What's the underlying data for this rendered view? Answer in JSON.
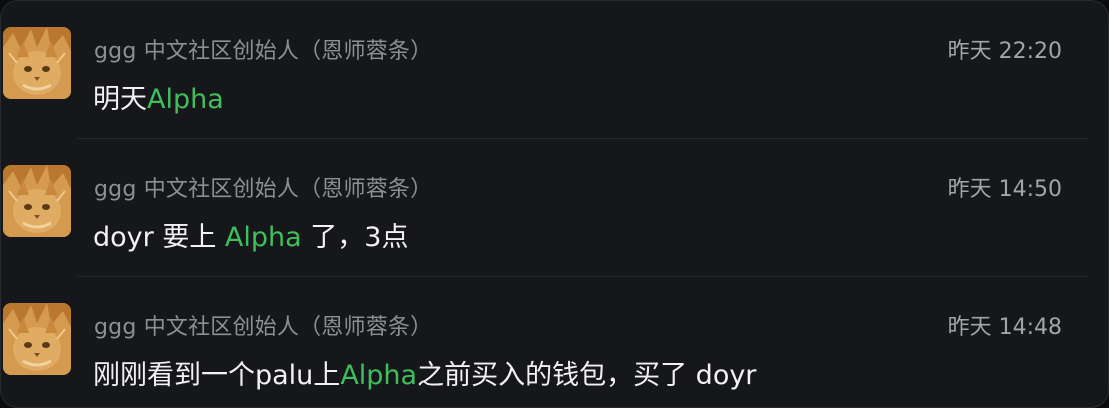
{
  "messages": [
    {
      "sender": "ggg 中文社区创始人（恩师蓉条）",
      "time": "昨天 22:20",
      "text_before": "明天",
      "highlight": "Alpha",
      "text_after": "",
      "avatar_icon": "orange-cat-avatar"
    },
    {
      "sender": "ggg 中文社区创始人（恩师蓉条）",
      "time": "昨天 14:50",
      "text_before": "doyr 要上 ",
      "highlight": "Alpha",
      "text_after": " 了，3点",
      "avatar_icon": "orange-cat-avatar"
    },
    {
      "sender": "ggg 中文社区创始人（恩师蓉条）",
      "time": "昨天 14:48",
      "text_before": "刚刚看到一个palu上",
      "highlight": "Alpha",
      "text_after": "之前买入的钱包，买了 doyr",
      "avatar_icon": "orange-cat-avatar"
    }
  ],
  "colors": {
    "background": "#16171a",
    "sender": "#8d8f95",
    "time": "#a2a4a9",
    "message_text": "#f2f2f2",
    "highlight": "#3fbf5c"
  }
}
